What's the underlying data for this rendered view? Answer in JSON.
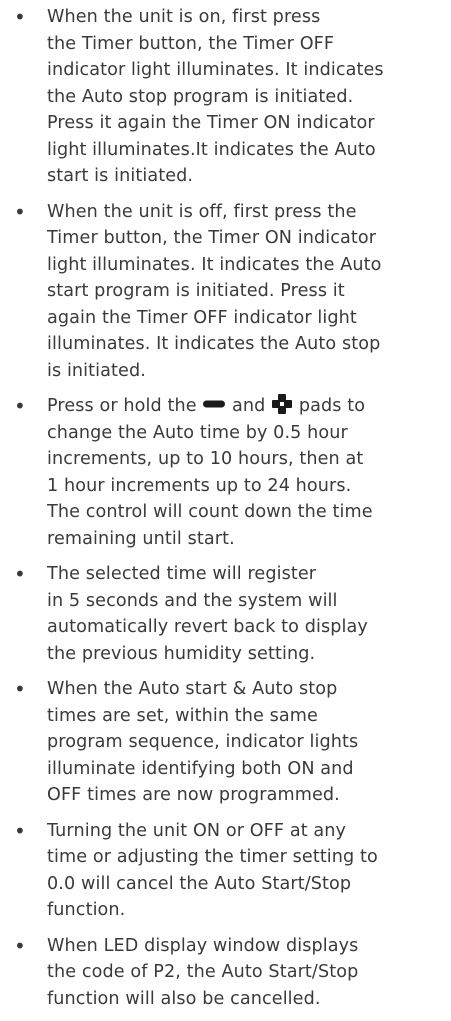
{
  "items": [
    {
      "text": "When the unit is on, first press\nthe Timer button, the Timer OFF\nindicator light illuminates. It indicates\nthe Auto stop program is initiated.\nPress it again the Timer ON indicator\nlight illuminates.It indicates the Auto\nstart is initiated."
    },
    {
      "text": "When the unit is off, first press the\nTimer button, the Timer ON indicator\nlight illuminates. It indicates the Auto\nstart program is initiated. Press it\nagain the Timer OFF indicator light\nilluminates. It indicates the Auto stop\nis initiated."
    },
    {
      "text_before_minus": "Press or hold the ",
      "text_between": " and ",
      "text_after_plus": " pads to\nchange the Auto time by 0.5 hour\nincrements, up to 10 hours, then at\n1 hour increments up to 24 hours.\nThe control will count down the time\nremaining until start.",
      "minus_icon": "minus-pad-icon",
      "plus_icon": "plus-pad-icon"
    },
    {
      "text": "The selected time will register\nin 5 seconds and the system will\nautomatically revert back to display\nthe previous humidity setting."
    },
    {
      "text": "When the Auto start & Auto stop\ntimes are set, within the same\nprogram sequence, indicator lights\nilluminate identifying both ON and\nOFF times are now programmed."
    },
    {
      "text": "Turning the unit ON or OFF at any\ntime or adjusting the timer setting to\n0.0 will cancel the Auto Start/Stop\nfunction."
    },
    {
      "text": "When LED display window displays\nthe code of P2, the Auto Start/Stop\nfunction will also be cancelled."
    }
  ],
  "bullet_char": "•",
  "text_color": "#3a3a3a",
  "icon_color": "#1a1a1a"
}
